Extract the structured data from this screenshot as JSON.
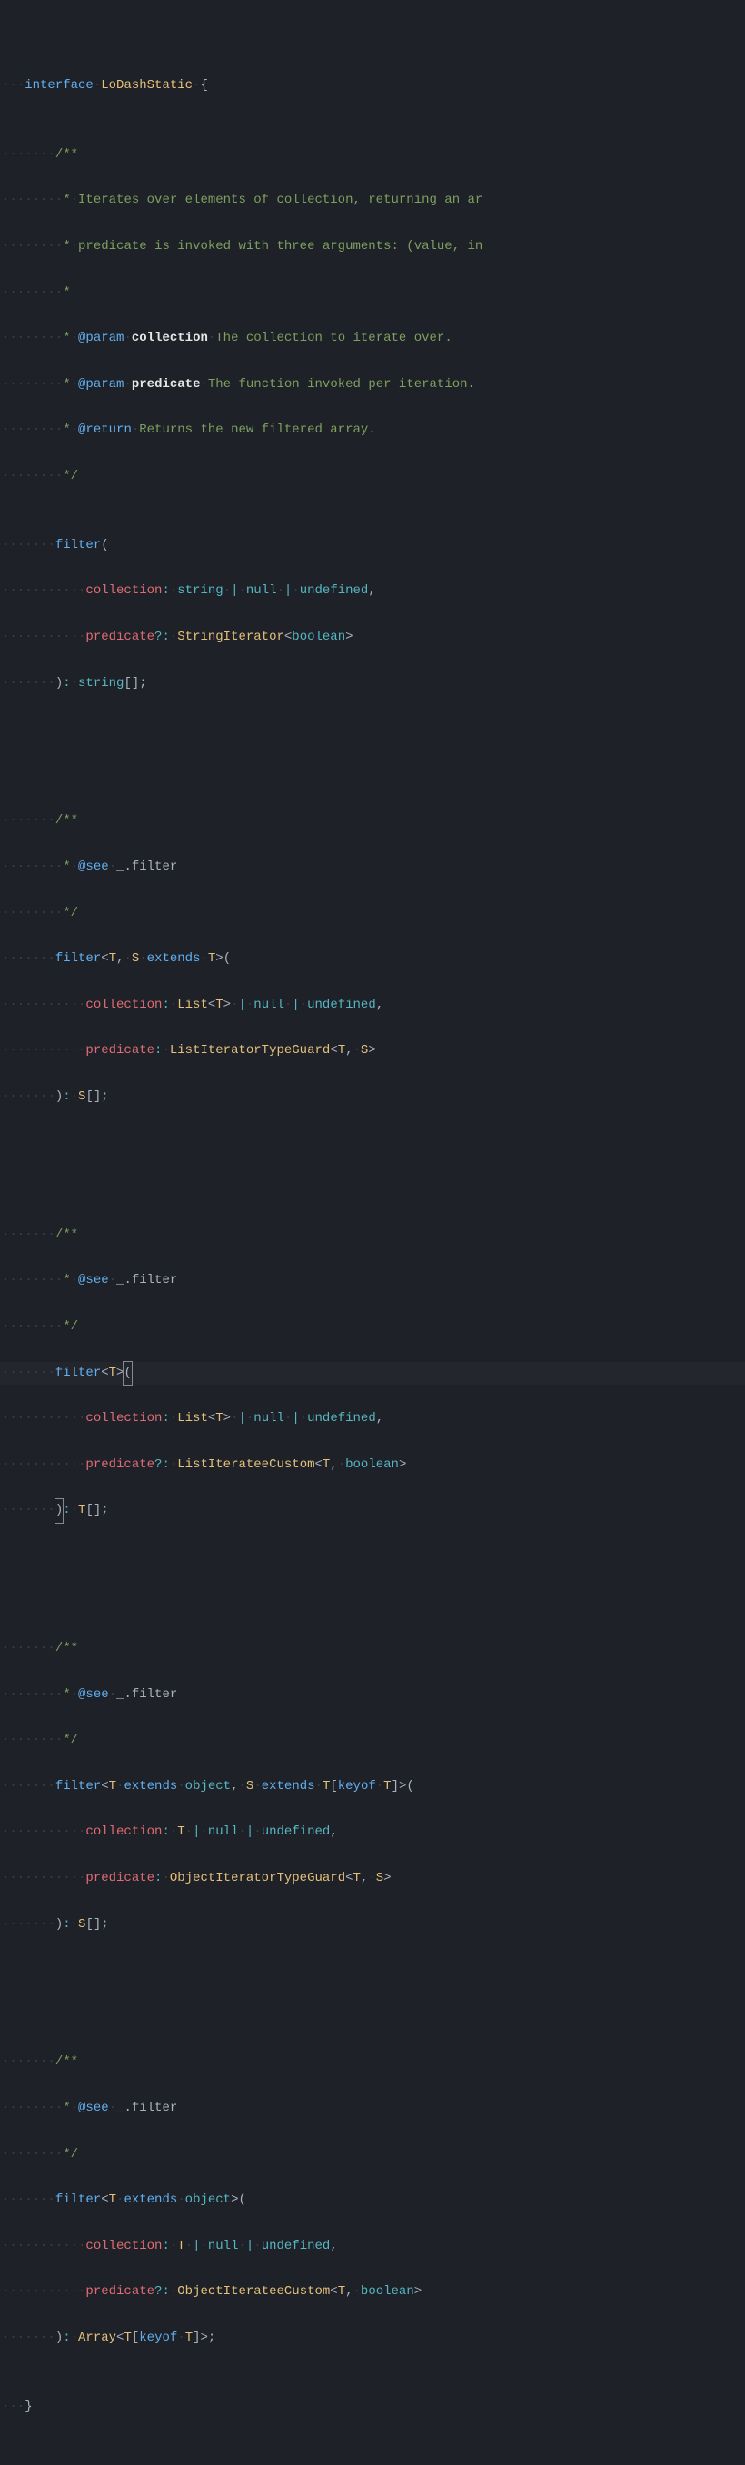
{
  "code": {
    "interface_kw": "interface",
    "interface_name": "LoDashStatic",
    "open_brace": "{",
    "close_brace": "}",
    "doc1": {
      "line1": "Iterates over elements of collection, returning an ar",
      "line2": "predicate is invoked with three arguments: (value, in",
      "param1_tag": "@param",
      "param1_name": "collection",
      "param1_desc": "The collection to iterate over.",
      "param2_tag": "@param",
      "param2_name": "predicate",
      "param2_desc": "The function invoked per iteration.",
      "return_tag": "@return",
      "return_desc": "Returns the new filtered array."
    },
    "see_tag": "@see",
    "see_ref": "_.filter",
    "fn_name": "filter",
    "sig1": {
      "p1_name": "collection",
      "p1_type": "string",
      "null": "null",
      "undef": "undefined",
      "p2_name": "predicate",
      "p2_type": "StringIterator",
      "p2_gen": "boolean",
      "ret": "string"
    },
    "sig2": {
      "gen_t": "T",
      "gen_s": "S",
      "extends": "extends",
      "p1_name": "collection",
      "p1_type": "List",
      "null": "null",
      "undef": "undefined",
      "p2_name": "predicate",
      "p2_type": "ListIteratorTypeGuard",
      "ret": "S"
    },
    "sig3": {
      "gen_t": "T",
      "p1_name": "collection",
      "p1_type": "List",
      "null": "null",
      "undef": "undefined",
      "p2_name": "predicate",
      "p2_type": "ListIterateeCustom",
      "p2_gen2": "boolean",
      "ret": "T"
    },
    "sig4": {
      "gen_t": "T",
      "extends": "extends",
      "object": "object",
      "gen_s": "S",
      "keyof": "keyof",
      "p1_name": "collection",
      "null": "null",
      "undef": "undefined",
      "p2_name": "predicate",
      "p2_type": "ObjectIteratorTypeGuard",
      "ret": "S"
    },
    "sig5": {
      "gen_t": "T",
      "extends": "extends",
      "object": "object",
      "p1_name": "collection",
      "null": "null",
      "undef": "undefined",
      "p2_name": "predicate",
      "p2_type": "ObjectIterateeCustom",
      "p2_gen2": "boolean",
      "ret_type": "Array",
      "keyof": "keyof"
    }
  }
}
